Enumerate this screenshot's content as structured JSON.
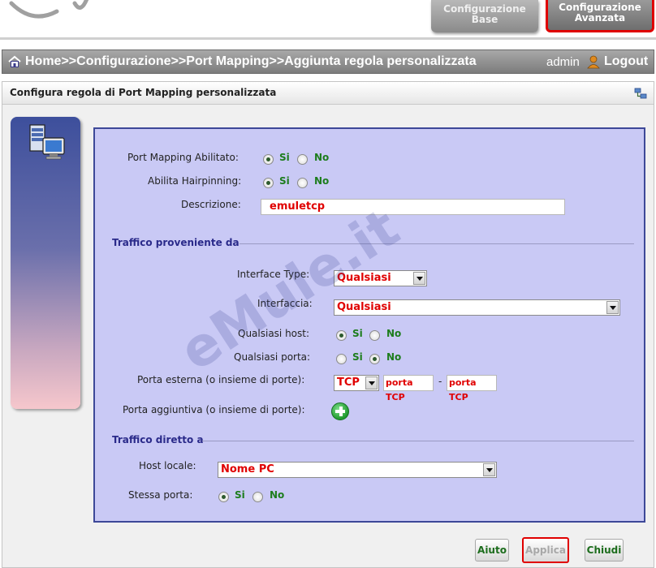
{
  "header": {
    "tab_base": "Configurazione\nBase",
    "tab_advanced": "Configurazione\nAvanzata"
  },
  "breadcrumb": {
    "path": "Home>>Configurazione>>Port Mapping>>Aggiunta regola personalizzata",
    "user": "admin",
    "logout": "Logout"
  },
  "panel": {
    "title": "Configura regola di Port Mapping personalizzata"
  },
  "form": {
    "port_mapping_enabled": {
      "label": "Port Mapping Abilitato:",
      "yes": "Si",
      "no": "No",
      "selected": "Si"
    },
    "hairpinning": {
      "label": "Abilita Hairpinning:",
      "yes": "Si",
      "no": "No",
      "selected": "Si"
    },
    "description": {
      "label": "Descrizione:",
      "value": "emuletcp"
    },
    "section_source": "Traffico proveniente da",
    "interface_type": {
      "label": "Interface Type:",
      "value": "Qualsiasi"
    },
    "interface": {
      "label": "Interfaccia:",
      "value": "Qualsiasi"
    },
    "any_host": {
      "label": "Qualsiasi host:",
      "yes": "Si",
      "no": "No",
      "selected": "Si"
    },
    "any_port": {
      "label": "Qualsiasi porta:",
      "yes": "Si",
      "no": "No",
      "selected": "No"
    },
    "external_port": {
      "label": "Porta esterna (o insieme di porte):",
      "protocol": "TCP",
      "from": "porta TCP",
      "separator": "-",
      "to": "porta TCP"
    },
    "additional_port": {
      "label": "Porta aggiuntiva (o insieme di porte):"
    },
    "section_dest": "Traffico diretto a",
    "local_host": {
      "label": "Host locale:",
      "value": "Nome PC"
    },
    "same_port": {
      "label": "Stessa porta:",
      "yes": "Si",
      "no": "No",
      "selected": "Si"
    }
  },
  "buttons": {
    "help": "Aiuto",
    "apply": "Applica",
    "close": "Chiudi"
  },
  "watermark": "eMule.it",
  "colors": {
    "accent_red": "#e00000",
    "option_green": "#1d7d1d",
    "form_background": "#c9c9f5",
    "form_border": "#3d4898"
  }
}
